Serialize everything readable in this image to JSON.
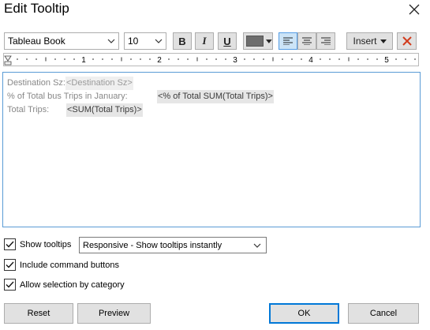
{
  "window": {
    "title": "Edit Tooltip"
  },
  "toolbar": {
    "font_family": "Tableau Book",
    "font_size": "10",
    "bold_label": "B",
    "italic_label": "I",
    "underline_label": "U",
    "text_color": "#6d6d6d",
    "insert_label": "Insert",
    "clear_color": "#d23c1e"
  },
  "ruler": {
    "marks": [
      "1",
      "2",
      "3",
      "4",
      "5"
    ]
  },
  "editor": {
    "line1_label": "Destination Sz:",
    "line1_field": "<Destination Sz>",
    "line2_label": "% of Total bus Trips in January:",
    "line2_field": "<% of Total SUM(Total Trips)>",
    "line3_label": "Total Trips:",
    "line3_field": "<SUM(Total Trips)>"
  },
  "options": {
    "show_tooltips": {
      "label": "Show tooltips",
      "checked": true
    },
    "tooltip_mode": "Responsive - Show tooltips instantly",
    "include_command_buttons": {
      "label": "Include command buttons",
      "checked": true
    },
    "allow_selection": {
      "label": "Allow selection by category",
      "checked": true
    }
  },
  "buttons": {
    "reset": "Reset",
    "preview": "Preview",
    "ok": "OK",
    "cancel": "Cancel"
  }
}
